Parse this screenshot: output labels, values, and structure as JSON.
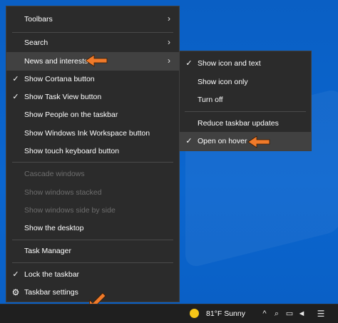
{
  "menu": {
    "items": [
      {
        "label": "Toolbars",
        "checked": false,
        "submenu": true,
        "disabled": false
      },
      {
        "label": "Search",
        "checked": false,
        "submenu": true,
        "disabled": false
      },
      {
        "label": "News and interests",
        "checked": false,
        "submenu": true,
        "disabled": false,
        "highlighted": true
      },
      {
        "label": "Show Cortana button",
        "checked": true,
        "submenu": false,
        "disabled": false
      },
      {
        "label": "Show Task View button",
        "checked": true,
        "submenu": false,
        "disabled": false
      },
      {
        "label": "Show People on the taskbar",
        "checked": false,
        "submenu": false,
        "disabled": false
      },
      {
        "label": "Show Windows Ink Workspace button",
        "checked": false,
        "submenu": false,
        "disabled": false
      },
      {
        "label": "Show touch keyboard button",
        "checked": false,
        "submenu": false,
        "disabled": false
      },
      {
        "label": "Cascade windows",
        "checked": false,
        "submenu": false,
        "disabled": true
      },
      {
        "label": "Show windows stacked",
        "checked": false,
        "submenu": false,
        "disabled": true
      },
      {
        "label": "Show windows side by side",
        "checked": false,
        "submenu": false,
        "disabled": true
      },
      {
        "label": "Show the desktop",
        "checked": false,
        "submenu": false,
        "disabled": false
      },
      {
        "label": "Task Manager",
        "checked": false,
        "submenu": false,
        "disabled": false
      },
      {
        "label": "Lock the taskbar",
        "checked": true,
        "submenu": false,
        "disabled": false
      },
      {
        "label": "Taskbar settings",
        "icon": "gear-icon",
        "submenu": false,
        "disabled": false
      }
    ]
  },
  "submenu": {
    "items": [
      {
        "label": "Show icon and text",
        "checked": true
      },
      {
        "label": "Show icon only",
        "checked": false
      },
      {
        "label": "Turn off",
        "checked": false
      },
      {
        "label": "Reduce taskbar updates",
        "checked": false
      },
      {
        "label": "Open on hover",
        "checked": true,
        "highlighted": true
      }
    ]
  },
  "taskbar": {
    "weather_icon": "sun-icon",
    "weather_text": "81°F  Sunny",
    "tray_icons": [
      "up-chevron-icon",
      "chat-icon",
      "network-icon",
      "volume-icon",
      "notification-icon"
    ]
  },
  "glyphs": {
    "check": "✓",
    "chevron": "›"
  },
  "colors": {
    "accent_arrow": "#f07a2a",
    "menu_bg": "#2b2b2b",
    "desktop": "#0b63c9"
  }
}
